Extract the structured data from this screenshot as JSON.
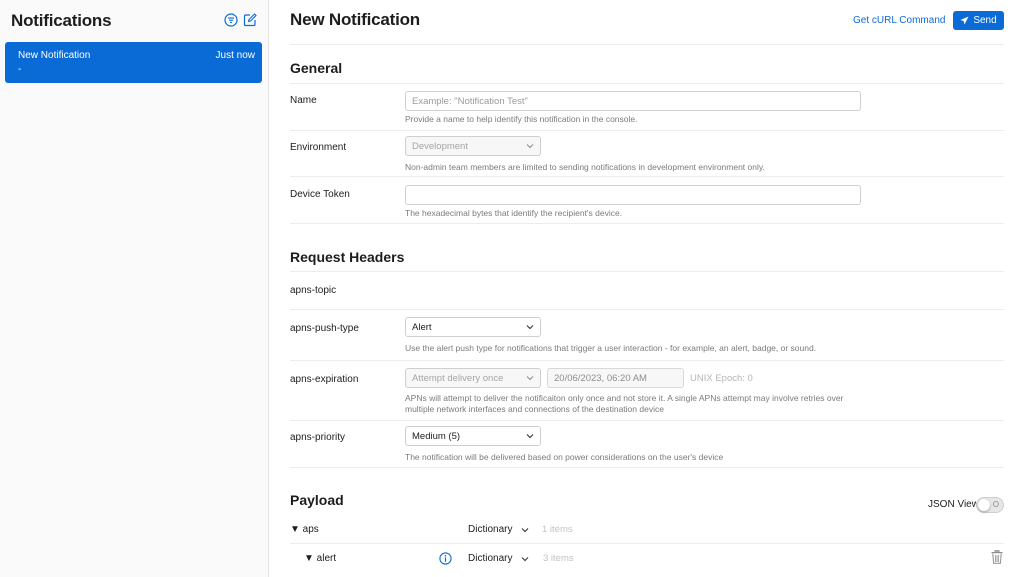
{
  "sidebar": {
    "title": "Notifications",
    "filter_icon": "filter-circle-icon",
    "compose_icon": "compose-icon",
    "items": [
      {
        "name": "New Notification",
        "time": "Just now",
        "subtitle": "-"
      }
    ]
  },
  "header": {
    "title": "New Notification",
    "curl_label": "Get cURL Command",
    "send_label": "Send",
    "send_icon": "paper-plane-icon"
  },
  "general": {
    "title": "General",
    "name_label": "Name",
    "name_placeholder": "Example: \"Notification Test\"",
    "name_value": "",
    "name_hint": "Provide a name to help identify this notification in the console.",
    "environment_label": "Environment",
    "environment_value": "Development",
    "environment_hint": "Non-admin team members are limited to sending notifications in development environment only.",
    "device_token_label": "Device Token",
    "device_token_value": "",
    "device_token_hint": "The hexadecimal bytes that identify the recipient's device."
  },
  "headers": {
    "title": "Request Headers",
    "topic_label": "apns-topic",
    "push_type_label": "apns-push-type",
    "push_type_value": "Alert",
    "push_type_hint": "Use the alert push type for notifications that trigger a user interaction - for example, an alert, badge, or sound.",
    "expiration_label": "apns-expiration",
    "expiration_value": "Attempt delivery once",
    "expiration_date": "20/06/2023, 06:20 AM",
    "expiration_epoch": "UNIX Epoch: 0",
    "expiration_hint_1": "APNs will attempt to deliver the notificaiton only once and not store it. A single APNs attempt may involve retries over",
    "expiration_hint_2": "multiple network interfaces and connections of the destination device",
    "priority_label": "apns-priority",
    "priority_value": "Medium (5)",
    "priority_hint": "The notification will be delivered based on power considerations on the user's device"
  },
  "payload": {
    "title": "Payload",
    "json_view_label": "JSON View",
    "json_view_on": false,
    "rows": [
      {
        "key": "▼ aps",
        "type": "Dictionary",
        "count": "1 items"
      },
      {
        "key": "▼ alert",
        "type": "Dictionary",
        "count": "3 items"
      }
    ],
    "info_icon": "info-circle-icon",
    "trash_icon": "trash-icon"
  },
  "colors": {
    "accent": "#0a6bd7",
    "sidebar_bg": "#fafafa",
    "hint_text": "#7b7b7b"
  }
}
